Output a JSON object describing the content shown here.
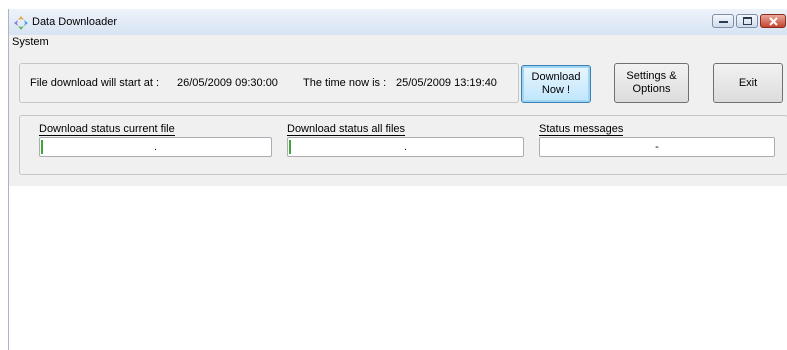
{
  "window": {
    "title": "Data Downloader",
    "icon": "app-icon"
  },
  "menu": {
    "items": [
      "System"
    ]
  },
  "schedule": {
    "start_label": "File download will start at :",
    "start_value": "26/05/2009 09:30:00",
    "now_label": "The time now is :",
    "now_value": "25/05/2009 13:19:40"
  },
  "buttons": {
    "download_line1": "Download",
    "download_line2": "Now !",
    "settings_line1": "Settings &",
    "settings_line2": "Options",
    "exit": "Exit"
  },
  "status": {
    "current_file_label": "Download status current file",
    "current_file_value": ".",
    "current_file_progress": 0.01,
    "all_files_label": "Download status all files",
    "all_files_value": ".",
    "all_files_progress": 0.01,
    "messages_label": "Status messages",
    "messages_value": "-"
  },
  "colors": {
    "progress": "#3ca53c",
    "close_button": "#c6452e"
  }
}
